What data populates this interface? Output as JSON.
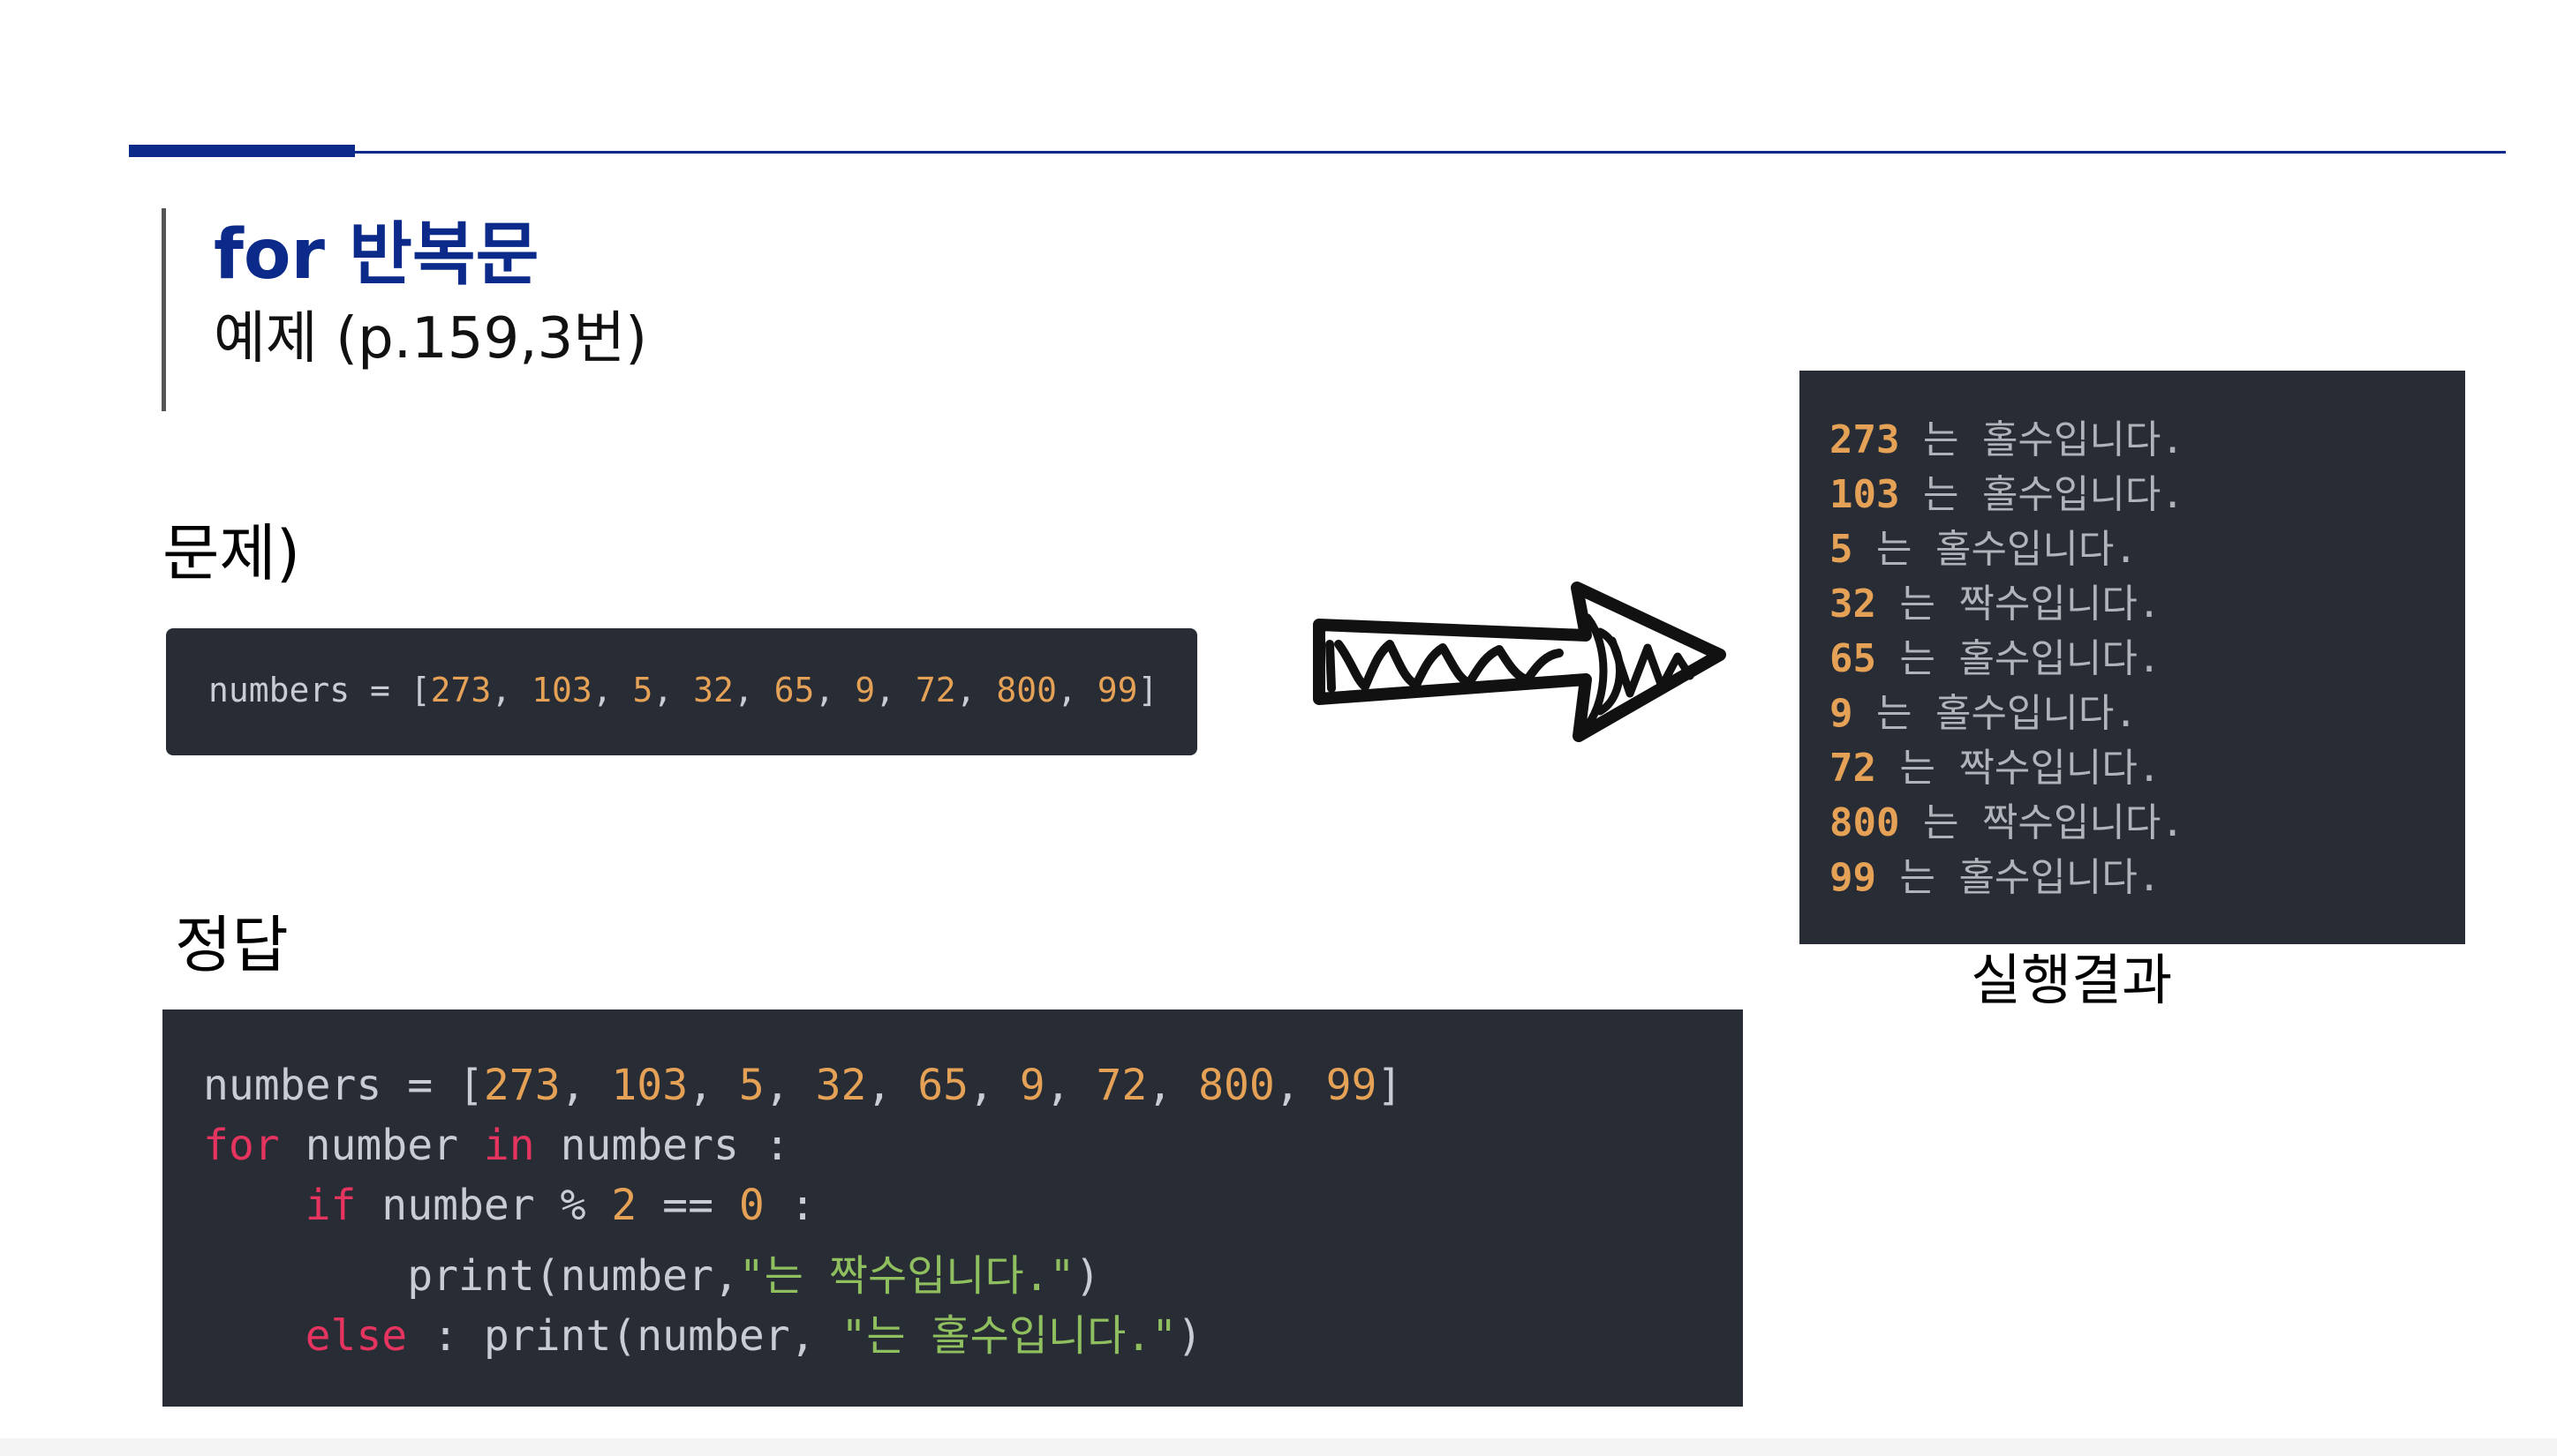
{
  "colors": {
    "navy": "#0b2a8a",
    "code_bg": "#282c34",
    "code_text": "#c8ccd4",
    "number": "#e5a257",
    "keyword": "#e5345f",
    "string": "#8fbf5f"
  },
  "header": {
    "title": "for 반복문",
    "subtitle": "예제 (p.159,3번)"
  },
  "problem": {
    "label": "문제)",
    "code_tokens": [
      {
        "t": "numbers = [",
        "c": "code_text"
      },
      {
        "t": "273",
        "c": "number"
      },
      {
        "t": ", ",
        "c": "code_text"
      },
      {
        "t": "103",
        "c": "number"
      },
      {
        "t": ", ",
        "c": "code_text"
      },
      {
        "t": "5",
        "c": "number"
      },
      {
        "t": ", ",
        "c": "code_text"
      },
      {
        "t": "32",
        "c": "number"
      },
      {
        "t": ", ",
        "c": "code_text"
      },
      {
        "t": "65",
        "c": "number"
      },
      {
        "t": ", ",
        "c": "code_text"
      },
      {
        "t": "9",
        "c": "number"
      },
      {
        "t": ", ",
        "c": "code_text"
      },
      {
        "t": "72",
        "c": "number"
      },
      {
        "t": ", ",
        "c": "code_text"
      },
      {
        "t": "800",
        "c": "number"
      },
      {
        "t": ", ",
        "c": "code_text"
      },
      {
        "t": "99",
        "c": "number"
      },
      {
        "t": "]",
        "c": "code_text"
      }
    ]
  },
  "answer": {
    "label": "정답",
    "lines": [
      [
        {
          "t": "numbers = [",
          "c": "code_text"
        },
        {
          "t": "273",
          "c": "number"
        },
        {
          "t": ", ",
          "c": "code_text"
        },
        {
          "t": "103",
          "c": "number"
        },
        {
          "t": ", ",
          "c": "code_text"
        },
        {
          "t": "5",
          "c": "number"
        },
        {
          "t": ", ",
          "c": "code_text"
        },
        {
          "t": "32",
          "c": "number"
        },
        {
          "t": ", ",
          "c": "code_text"
        },
        {
          "t": "65",
          "c": "number"
        },
        {
          "t": ", ",
          "c": "code_text"
        },
        {
          "t": "9",
          "c": "number"
        },
        {
          "t": ", ",
          "c": "code_text"
        },
        {
          "t": "72",
          "c": "number"
        },
        {
          "t": ", ",
          "c": "code_text"
        },
        {
          "t": "800",
          "c": "number"
        },
        {
          "t": ", ",
          "c": "code_text"
        },
        {
          "t": "99",
          "c": "number"
        },
        {
          "t": "]",
          "c": "code_text"
        }
      ],
      [
        {
          "t": "for",
          "c": "keyword"
        },
        {
          "t": " number ",
          "c": "code_text"
        },
        {
          "t": "in",
          "c": "keyword"
        },
        {
          "t": " numbers :",
          "c": "code_text"
        }
      ],
      [
        {
          "t": "    ",
          "c": "code_text"
        },
        {
          "t": "if",
          "c": "keyword"
        },
        {
          "t": " number % ",
          "c": "code_text"
        },
        {
          "t": "2",
          "c": "number"
        },
        {
          "t": " == ",
          "c": "code_text"
        },
        {
          "t": "0",
          "c": "number"
        },
        {
          "t": " :",
          "c": "code_text"
        }
      ],
      [
        {
          "t": "        print(number,",
          "c": "code_text"
        },
        {
          "t": "\"는 짝수입니다.\"",
          "c": "string"
        },
        {
          "t": ")",
          "c": "code_text"
        }
      ],
      [
        {
          "t": "    ",
          "c": "code_text"
        },
        {
          "t": "else",
          "c": "keyword"
        },
        {
          "t": " : print(number, ",
          "c": "code_text"
        },
        {
          "t": "\"는 홀수입니다.\"",
          "c": "string"
        },
        {
          "t": ")",
          "c": "code_text"
        }
      ]
    ]
  },
  "output": {
    "caption": "실행결과",
    "lines": [
      {
        "num": "273",
        "text": " 는 홀수입니다."
      },
      {
        "num": "103",
        "text": " 는 홀수입니다."
      },
      {
        "num": "5",
        "text": " 는 홀수입니다."
      },
      {
        "num": "32",
        "text": " 는 짝수입니다."
      },
      {
        "num": "65",
        "text": " 는 홀수입니다."
      },
      {
        "num": "9",
        "text": " 는 홀수입니다."
      },
      {
        "num": "72",
        "text": " 는 짝수입니다."
      },
      {
        "num": "800",
        "text": " 는 짝수입니다."
      },
      {
        "num": "99",
        "text": " 는 홀수입니다."
      }
    ]
  }
}
